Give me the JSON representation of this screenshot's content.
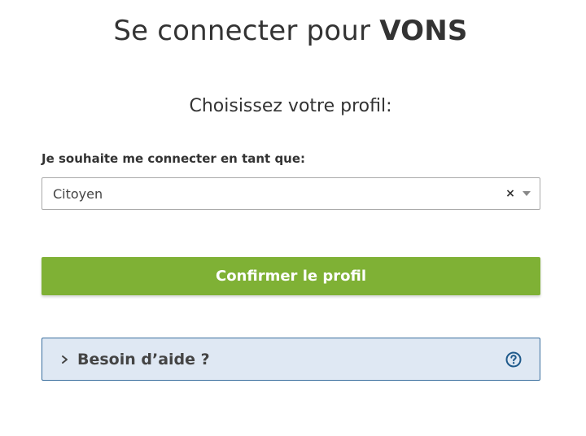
{
  "header": {
    "title_prefix": "Se connecter pour ",
    "title_brand": "VONS"
  },
  "profile": {
    "subtitle": "Choisissez votre profil:",
    "field_label": "Je souhaite me connecter en tant que:",
    "selected_value": "Citoyen",
    "clear_symbol": "×"
  },
  "actions": {
    "confirm_label": "Confirmer le profil"
  },
  "help": {
    "label": "Besoin d’aide ?",
    "chevron_icon": "chevron-right-icon",
    "help_icon": "question-circle-icon"
  },
  "colors": {
    "confirm_bg": "#7fb135",
    "help_bg": "#dfe8f3",
    "help_border": "#3a6f9e",
    "help_icon": "#1f5a8b"
  }
}
